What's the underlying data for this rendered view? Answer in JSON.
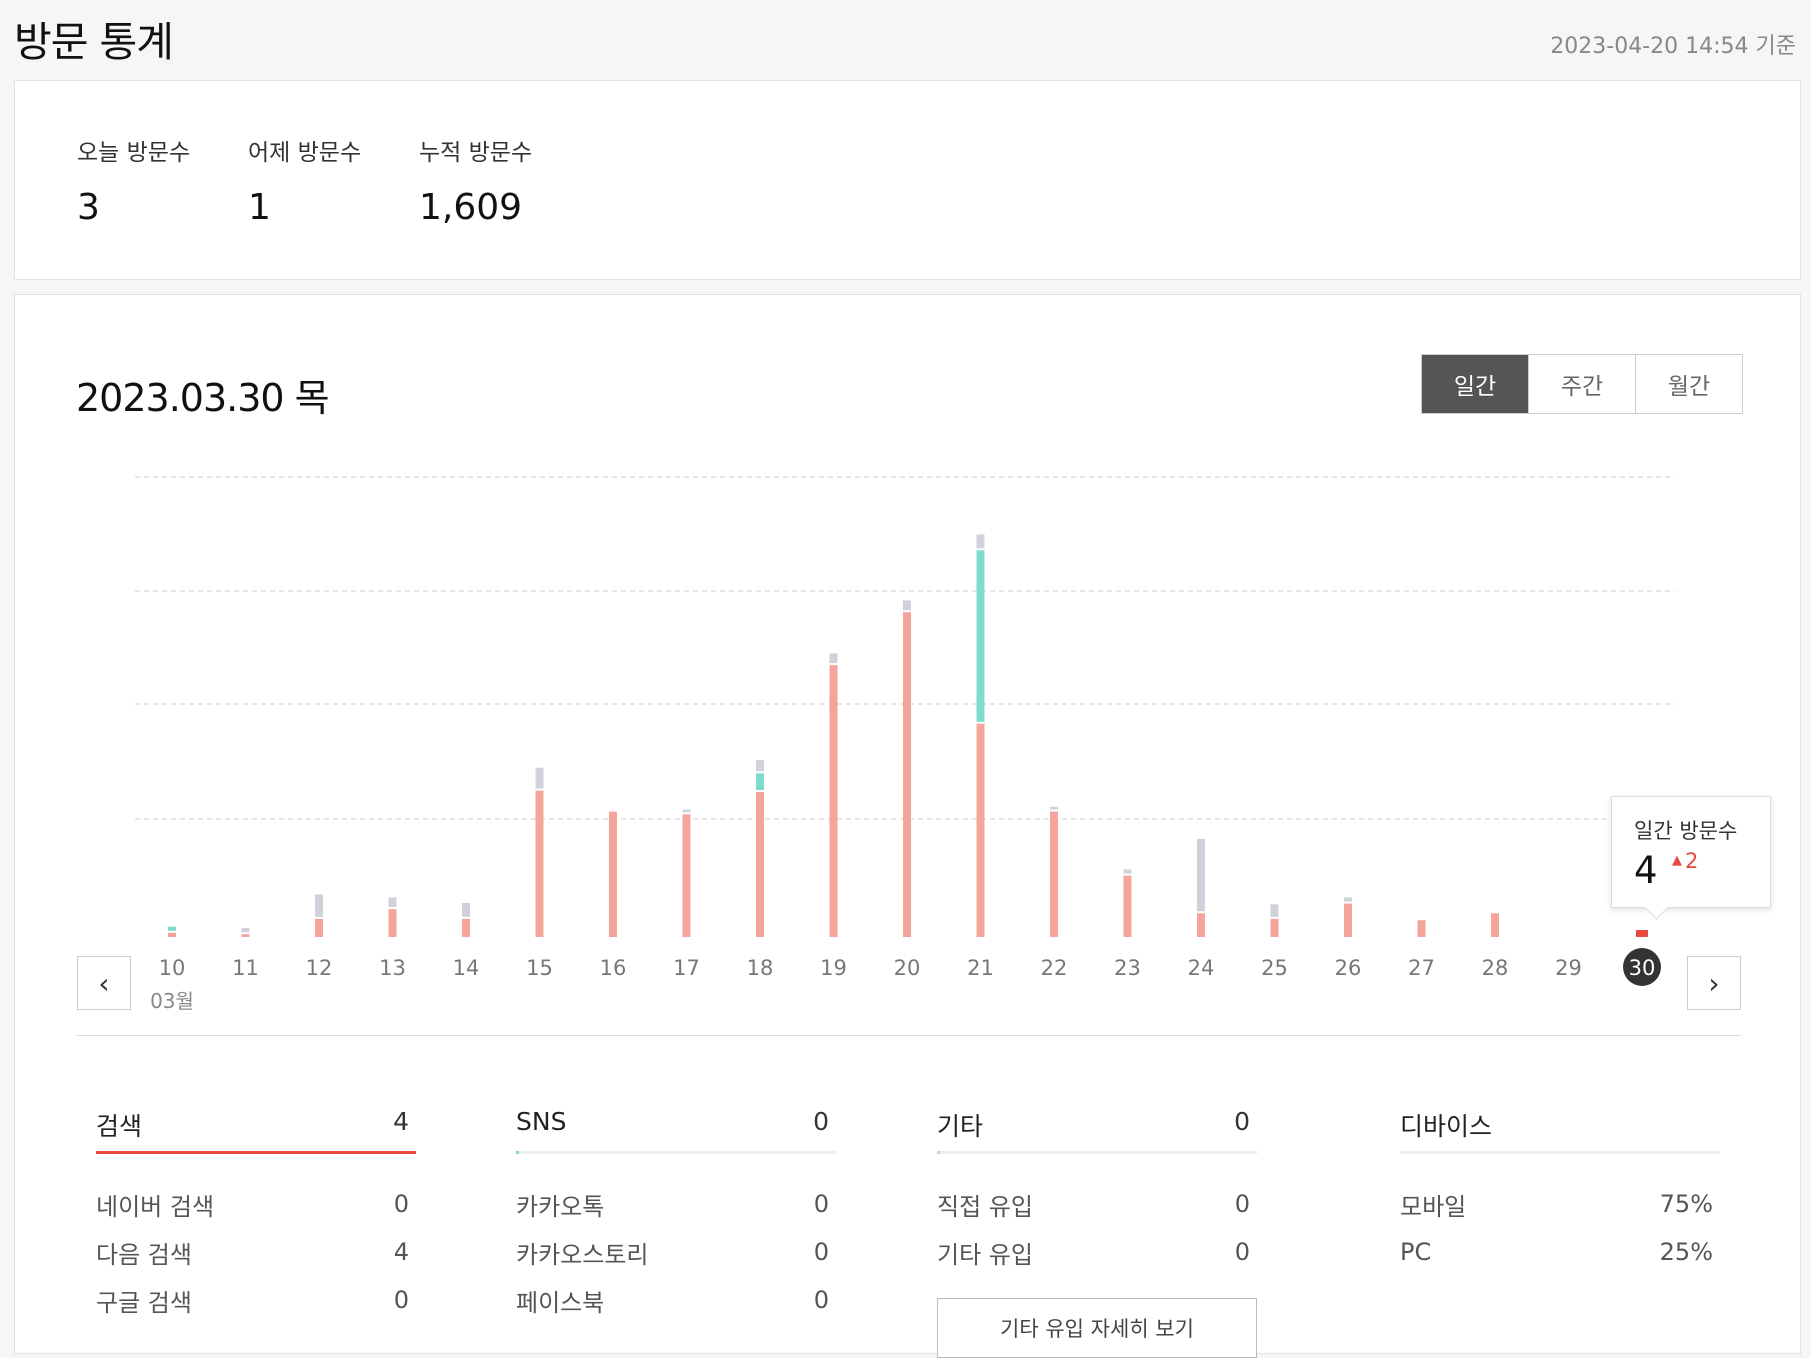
{
  "header": {
    "title": "방문 통계",
    "timestamp": "2023-04-20 14:54 기준"
  },
  "summary": {
    "today_label": "오늘 방문수",
    "today_value": "3",
    "yesterday_label": "어제 방문수",
    "yesterday_value": "1",
    "total_label": "누적 방문수",
    "total_value": "1,609"
  },
  "chart_header": {
    "date": "2023.03.30 목",
    "periods": [
      "일간",
      "주간",
      "월간"
    ],
    "active_period": "일간"
  },
  "tooltip": {
    "label": "일간 방문수",
    "value": "4",
    "diff": "2",
    "diff_icon": "triangle-up-icon"
  },
  "colors": {
    "search": "#f5a49b",
    "sns": "#7fdccc",
    "other": "#cfd3d9",
    "selected": "#e8493f",
    "accent_red": "#e8493f"
  },
  "chart_data": {
    "type": "bar",
    "stacked": true,
    "month_label": "03월",
    "categories": [
      "10",
      "11",
      "12",
      "13",
      "14",
      "15",
      "16",
      "17",
      "18",
      "19",
      "20",
      "21",
      "22",
      "23",
      "24",
      "25",
      "26",
      "27",
      "28",
      "29",
      "30"
    ],
    "selected": "30",
    "series": [
      {
        "key": "search",
        "values": [
          0.3,
          0.2,
          1.3,
          2.0,
          1.3,
          10.5,
          9.0,
          8.8,
          10.4,
          19.5,
          23.3,
          15.3,
          9.0,
          4.4,
          1.7,
          1.3,
          2.4,
          1.2,
          1.7,
          0,
          0
        ]
      },
      {
        "key": "sns",
        "values": [
          0.3,
          0,
          0,
          0,
          0,
          0,
          0,
          0,
          1.2,
          0,
          0,
          12.3,
          0,
          0,
          0,
          0,
          0,
          0,
          0,
          0,
          0
        ]
      },
      {
        "key": "other",
        "values": [
          0,
          0.3,
          1.6,
          0.7,
          1.0,
          1.5,
          0,
          0.2,
          0.8,
          0.7,
          0.7,
          1.0,
          0.2,
          0.3,
          5.2,
          0.9,
          0.3,
          0,
          0,
          0,
          0.4
        ]
      }
    ],
    "ylim": [
      0,
      33
    ],
    "grid": true
  },
  "sections": [
    {
      "title": "검색",
      "count": "4",
      "fill": 1.0,
      "color_key": "accent_red",
      "rows": [
        {
          "label": "네이버 검색",
          "value": "0"
        },
        {
          "label": "다음 검색",
          "value": "4"
        },
        {
          "label": "구글 검색",
          "value": "0"
        }
      ]
    },
    {
      "title": "SNS",
      "count": "0",
      "fill": 0.01,
      "color_key": "sns",
      "rows": [
        {
          "label": "카카오톡",
          "value": "0"
        },
        {
          "label": "카카오스토리",
          "value": "0"
        },
        {
          "label": "페이스북",
          "value": "0"
        }
      ]
    },
    {
      "title": "기타",
      "count": "0",
      "fill": 0.01,
      "color_key": "other",
      "rows": [
        {
          "label": "직접 유입",
          "value": "0"
        },
        {
          "label": "기타 유입",
          "value": "0"
        }
      ]
    },
    {
      "title": "디바이스",
      "count": "",
      "fill": 0,
      "color_key": "other",
      "rows": [
        {
          "label": "모바일",
          "value": "75%"
        },
        {
          "label": "PC",
          "value": "25%"
        }
      ]
    }
  ],
  "detail_button": "기타 유입 자세히 보기"
}
